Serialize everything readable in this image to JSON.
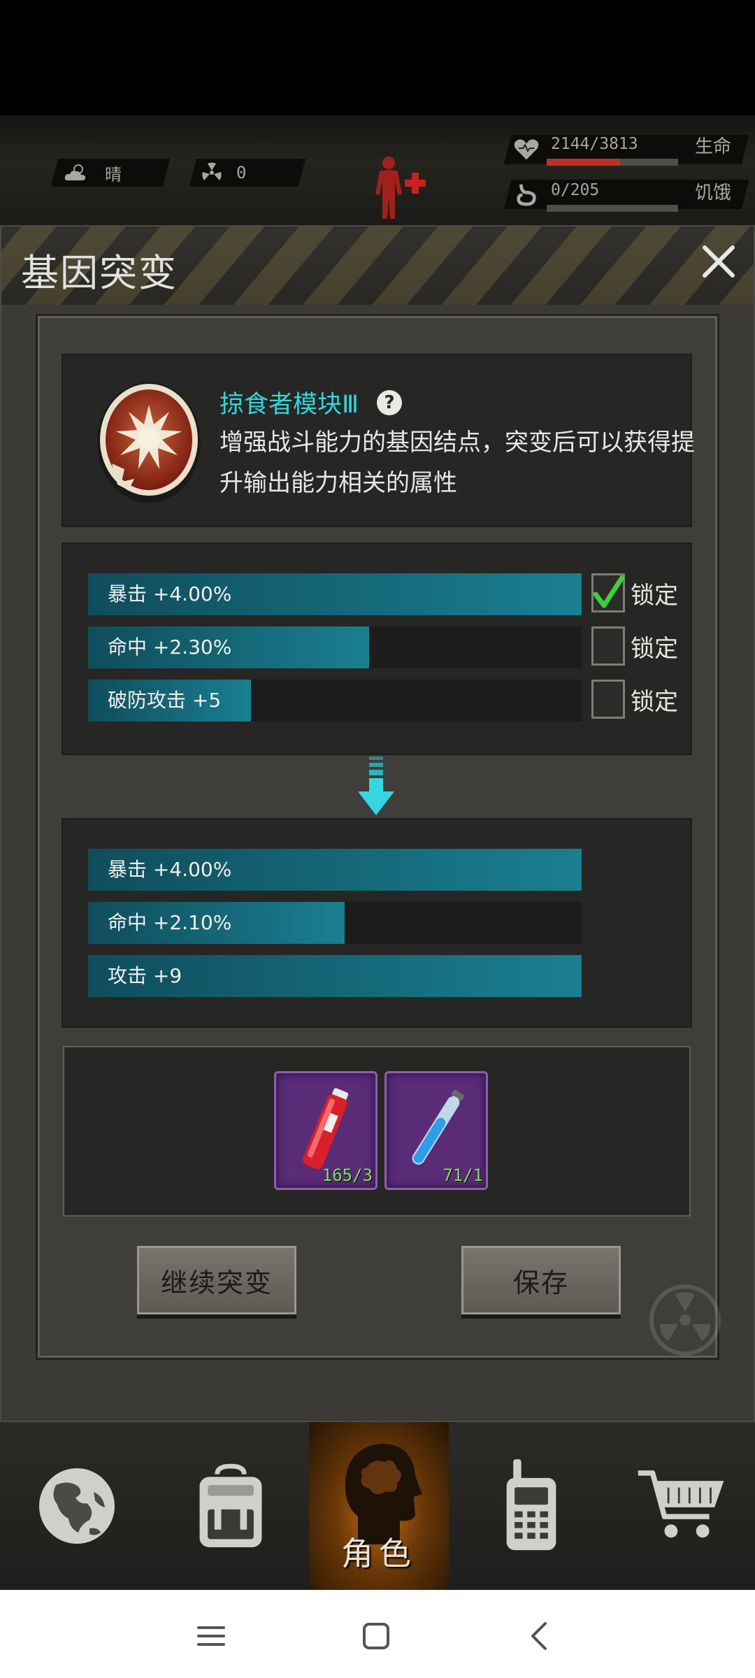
{
  "status": {
    "weather": "晴",
    "radiation": "0",
    "life_text": "2144/3813",
    "life_fraction": 0.56,
    "life_label": "生命",
    "hunger_text": "0/205",
    "hunger_fraction": 0.0,
    "hunger_label": "饥饿"
  },
  "modal": {
    "title": "基因突变",
    "gene": {
      "name": "掠食者模块Ⅲ",
      "description": "增强战斗能力的基因结点，突变后可以获得提升输出能力相关的属性"
    },
    "current_stats": [
      {
        "label": "暴击 +4.00%",
        "fill": 1.0,
        "locked": true,
        "lock_label": "锁定"
      },
      {
        "label": "命中 +2.30%",
        "fill": 0.57,
        "locked": false,
        "lock_label": "锁定"
      },
      {
        "label": "破防攻击 +5",
        "fill": 0.33,
        "locked": false,
        "lock_label": "锁定"
      }
    ],
    "new_stats": [
      {
        "label": "暴击 +4.00%",
        "fill": 1.0
      },
      {
        "label": "命中 +2.10%",
        "fill": 0.52
      },
      {
        "label": "攻击 +9",
        "fill": 1.0
      }
    ],
    "items": [
      {
        "name": "red-serum",
        "count": "165/3"
      },
      {
        "name": "blue-serum",
        "count": "71/1"
      }
    ],
    "buttons": {
      "continue": "继续突变",
      "save": "保存"
    }
  },
  "nav": {
    "items": [
      "world",
      "backpack",
      "character",
      "radio",
      "shop"
    ],
    "active_label": "角色"
  },
  "colors": {
    "accent_teal": "#1a7f90",
    "gene_name": "#35d3dc",
    "life_bar": "#c0302a",
    "item_bg": "#5a2c78",
    "check": "#3fcf3a"
  }
}
